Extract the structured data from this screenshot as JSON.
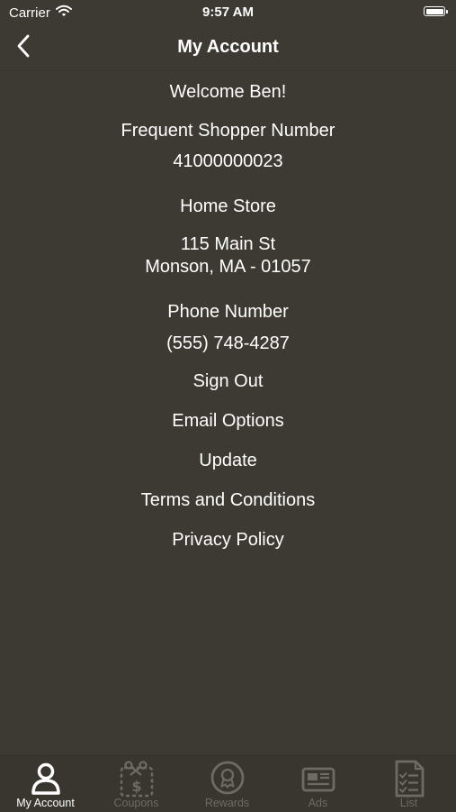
{
  "status_bar": {
    "carrier": "Carrier",
    "time": "9:57 AM",
    "wifi_icon": "wifi-icon",
    "battery_icon": "battery-icon",
    "battery_level": 1.0
  },
  "nav": {
    "title": "My Account",
    "back_icon": "chevron-left-icon"
  },
  "account": {
    "welcome": "Welcome Ben!",
    "shopper_label": "Frequent Shopper Number",
    "shopper_number": "41000000023",
    "home_store_label": "Home Store",
    "store_address_line1": "115 Main St",
    "store_address_line2": "Monson, MA - 01057",
    "phone_label": "Phone Number",
    "phone_number": "(555) 748-4287"
  },
  "menu": {
    "sign_out": "Sign Out",
    "email_options": "Email Options",
    "update": "Update",
    "terms": "Terms and Conditions",
    "privacy": "Privacy Policy"
  },
  "tabs": [
    {
      "label": "My Account",
      "icon": "person-icon",
      "active": true
    },
    {
      "label": "Coupons",
      "icon": "coupon-scissors-icon",
      "active": false
    },
    {
      "label": "Rewards",
      "icon": "rewards-badge-icon",
      "active": false
    },
    {
      "label": "Ads",
      "icon": "newspaper-icon",
      "active": false
    },
    {
      "label": "List",
      "icon": "checklist-icon",
      "active": false
    }
  ],
  "colors": {
    "background": "#3d3933",
    "text": "#ffffff",
    "tab_inactive": "#6e6a64",
    "tab_active": "#ffffff"
  }
}
